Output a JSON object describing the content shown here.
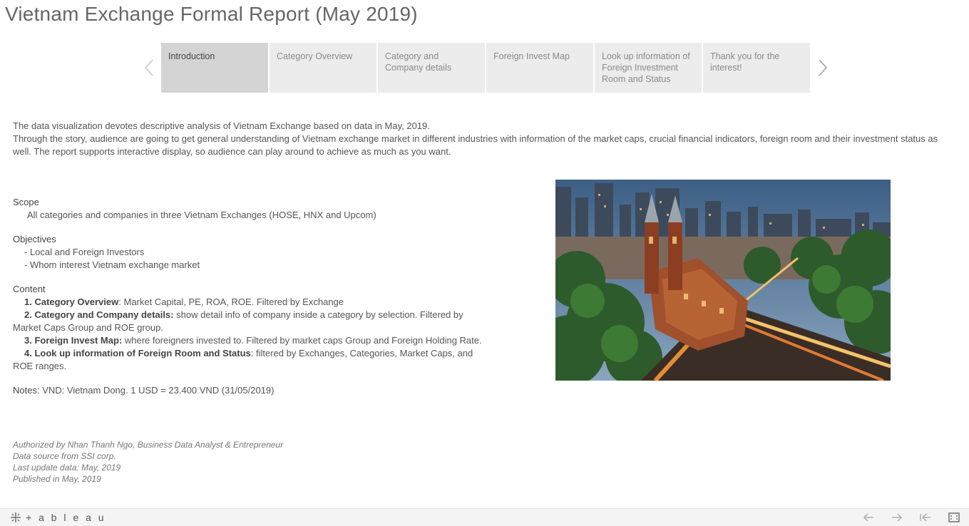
{
  "header": {
    "title": "Vietnam Exchange Formal Report (May 2019)"
  },
  "tabs": [
    {
      "label": "Introduction",
      "active": true
    },
    {
      "label": "Category Overview",
      "active": false
    },
    {
      "label": "Category and Company details",
      "active": false
    },
    {
      "label": "Foreign Invest Map",
      "active": false
    },
    {
      "label": "Look up information of Foreign Investment Room and Status",
      "active": false
    },
    {
      "label": "Thank you for the interest!",
      "active": false
    }
  ],
  "intro": {
    "line1": "The data visualization devotes descriptive analysis of Vietnam Exchange based on data in May, 2019.",
    "line2": "Through the story, audience are going to get general understanding of Vietnam exchange market in different industries with information of the market caps, crucial financial indicators, foreign room and their investment status as well. The report supports interactive display, so audience can play around to achieve as much as you want."
  },
  "scope": {
    "heading": "Scope",
    "text": "All categories and companies in three Vietnam Exchanges (HOSE, HNX and Upcom)"
  },
  "objectives": {
    "heading": "Objectives",
    "items": [
      "- Local and Foreign Investors",
      "- Whom interest Vietnam exchange market"
    ]
  },
  "content": {
    "heading": "Content",
    "items": [
      {
        "title": "1. Category Overview",
        "text": ": Market Capital, PE, ROA, ROE. Filtered by Exchange"
      },
      {
        "title": "2. Category and Company details:",
        "text": " show detail info of company inside a category by selection. Filtered by Market Caps Group and ROE group."
      },
      {
        "title": "3. Foreign Invest Map:",
        "text": " where foreigners invested to. Filtered by market caps Group and Foreign Holding Rate."
      },
      {
        "title": "4. Look up information of Foreign Room and Status",
        "text": ": filtered by Exchanges, Categories, Market Caps, and ROE ranges."
      }
    ]
  },
  "notes": {
    "label": "Notes:",
    "text": " VND: Vietnam Dong.  1 USD = 23.400 VND (31/05/2019)"
  },
  "credits": [
    "Authorized by Nhan Thanh Ngo, Business Data Analyst & Entrepreneur",
    "Data source from SSI corp.",
    "Last update data: May, 2019",
    "Published in May, 2019"
  ],
  "footer": {
    "logo_text": "+ a b l e a u"
  },
  "icons": {
    "prev": "chevron-left-icon",
    "next": "chevron-right-icon",
    "undo": "arrow-left-icon",
    "redo": "arrow-right-icon",
    "revert": "revert-icon",
    "fullscreen": "fullscreen-icon"
  },
  "colors": {
    "active_tab": "#d4d4d4",
    "inactive_tab": "#ececec",
    "text": "#555555",
    "title": "#666666"
  }
}
